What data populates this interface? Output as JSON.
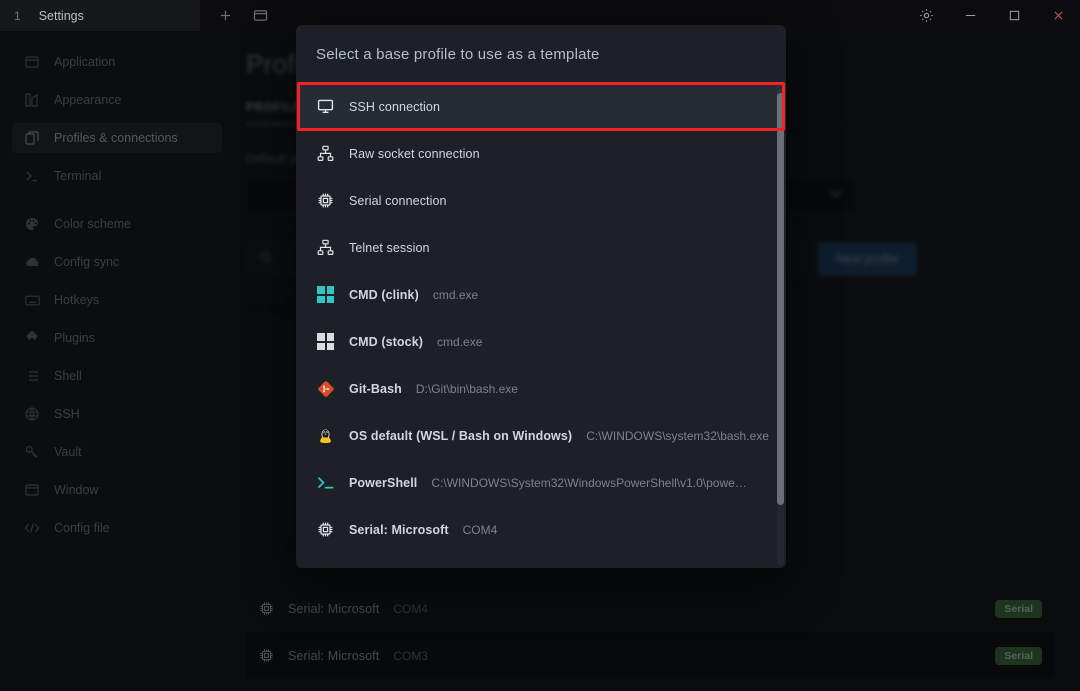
{
  "titlebar": {
    "tab_index": "1",
    "tab_title": "Settings",
    "new_tab_icon": "plus-icon",
    "split_icon": "window-icon",
    "settings_icon": "gear-icon",
    "minimize_label": "–",
    "maximize_label": "□",
    "close_label": "✕"
  },
  "sidebar": {
    "items": [
      {
        "label": "Application",
        "icon": "window-icon",
        "active": false
      },
      {
        "label": "Appearance",
        "icon": "palette-brush-icon",
        "active": false
      },
      {
        "label": "Profiles & connections",
        "icon": "copy-icon",
        "active": true
      },
      {
        "label": "Terminal",
        "icon": "prompt-icon",
        "active": false
      },
      {
        "label": "Color scheme",
        "icon": "palette-icon",
        "active": false
      },
      {
        "label": "Config sync",
        "icon": "cloud-icon",
        "active": false
      },
      {
        "label": "Hotkeys",
        "icon": "keyboard-icon",
        "active": false
      },
      {
        "label": "Plugins",
        "icon": "puzzle-icon",
        "active": false
      },
      {
        "label": "Shell",
        "icon": "list-icon",
        "active": false
      },
      {
        "label": "SSH",
        "icon": "globe-icon",
        "active": false
      },
      {
        "label": "Vault",
        "icon": "key-icon",
        "active": false
      },
      {
        "label": "Window",
        "icon": "window-icon",
        "active": false
      },
      {
        "label": "Config file",
        "icon": "code-icon",
        "active": false
      }
    ]
  },
  "main": {
    "page_title": "Profiles",
    "tabs": [
      {
        "label": "PROFILES",
        "selected": true
      }
    ],
    "default_profile_label": "Default profile",
    "default_profile_value": "",
    "dropdown_icon": "chevron-down-icon",
    "search_icon": "search-icon",
    "search_placeholder": "",
    "new_profile_button": "New profile",
    "group_label": "Built-in",
    "group_chevron": "chevron-down-icon",
    "profiles": [
      {
        "name": "Serial: Microsoft",
        "sub": "COM4",
        "badge": "Serial",
        "icon": "chip-icon"
      },
      {
        "name": "Serial: Microsoft",
        "sub": "COM3",
        "badge": "Serial",
        "icon": "chip-icon"
      }
    ]
  },
  "modal": {
    "title": "Select a base profile to use as a template",
    "highlighted_option_index": 0,
    "options": [
      {
        "name": "SSH connection",
        "sub": "",
        "icon": "monitor-icon",
        "bold": false,
        "selected": true
      },
      {
        "name": "Raw socket connection",
        "sub": "",
        "icon": "network-icon",
        "bold": false,
        "selected": false
      },
      {
        "name": "Serial connection",
        "sub": "",
        "icon": "chip-icon",
        "bold": false,
        "selected": false
      },
      {
        "name": "Telnet session",
        "sub": "",
        "icon": "network-icon",
        "bold": false,
        "selected": false
      },
      {
        "name": "CMD (clink)",
        "sub": "cmd.exe",
        "icon": "windows-teal-icon",
        "bold": true,
        "selected": false
      },
      {
        "name": "CMD (stock)",
        "sub": "cmd.exe",
        "icon": "windows-white-icon",
        "bold": true,
        "selected": false
      },
      {
        "name": "Git-Bash",
        "sub": "D:\\Git\\bin\\bash.exe",
        "icon": "git-icon",
        "bold": true,
        "selected": false
      },
      {
        "name": "OS default (WSL / Bash on Windows)",
        "sub": "C:\\WINDOWS\\system32\\bash.exe",
        "icon": "tux-icon",
        "bold": true,
        "selected": false
      },
      {
        "name": "PowerShell",
        "sub": "C:\\WINDOWS\\System32\\WindowsPowerShell\\v1.0\\powe…",
        "icon": "powershell-icon",
        "bold": true,
        "selected": false
      },
      {
        "name": "Serial: Microsoft",
        "sub": "COM4",
        "icon": "chip-icon",
        "bold": true,
        "selected": false
      }
    ]
  },
  "colors": {
    "annotation_red": "#f42222",
    "modal_bg": "#1d2027",
    "selected_row": "#272b33",
    "accent_blue": "#1c5089",
    "badge_green": "#3f7a3f",
    "teal": "#31c6c6",
    "git_red": "#dd4b25"
  }
}
